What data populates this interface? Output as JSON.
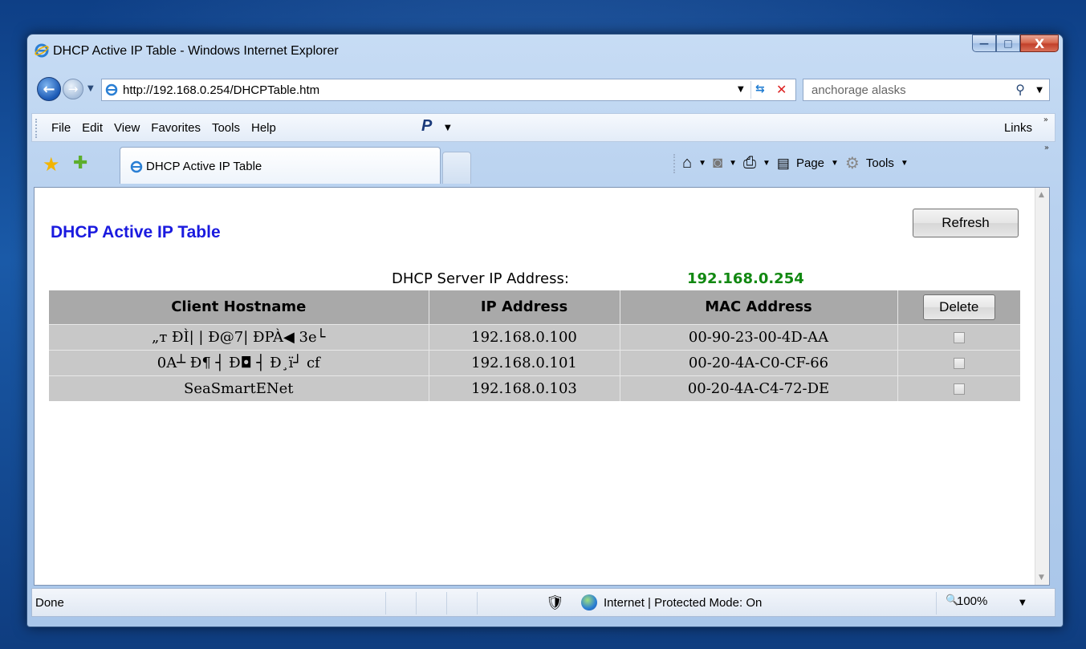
{
  "window": {
    "title": "DHCP Active IP Table - Windows Internet Explorer",
    "minimize_glyph": "—",
    "maximize_glyph": "□",
    "close_glyph": "X"
  },
  "address_bar": {
    "url": "http://192.168.0.254/DHCPTable.htm",
    "search_value": "anchorage alasks"
  },
  "menu": {
    "items": [
      "File",
      "Edit",
      "View",
      "Favorites",
      "Tools",
      "Help"
    ],
    "links_label": "Links"
  },
  "tabs": {
    "active_label": "DHCP Active IP Table"
  },
  "command_bar": {
    "page_label": "Page",
    "tools_label": "Tools"
  },
  "page": {
    "title": "DHCP Active IP Table",
    "refresh_label": "Refresh",
    "server_label": "DHCP Server IP Address:",
    "server_ip": "192.168.0.254",
    "server_ip_color": "#118811",
    "title_color": "#1a1adf",
    "columns": [
      "Client Hostname",
      "IP Address",
      "MAC Address"
    ],
    "delete_label": "Delete",
    "rows": [
      {
        "hostname": "„т ÐÌ| | Ð@7| ÐPÀ◀ 3e└",
        "ip": "192.168.0.100",
        "mac": "00-90-23-00-4D-AA",
        "checked": false
      },
      {
        "hostname": "0A┴ Ð¶ ┤ Ð◘ ┤ Ð¸ï┘ cf",
        "ip": "192.168.0.101",
        "mac": "00-20-4A-C0-CF-66",
        "checked": false
      },
      {
        "hostname": "SeaSmartENet",
        "ip": "192.168.0.103",
        "mac": "00-20-4A-C4-72-DE",
        "checked": false
      }
    ]
  },
  "status_bar": {
    "status": "Done",
    "zone": "Internet | Protected Mode: On",
    "zoom": "100%"
  }
}
